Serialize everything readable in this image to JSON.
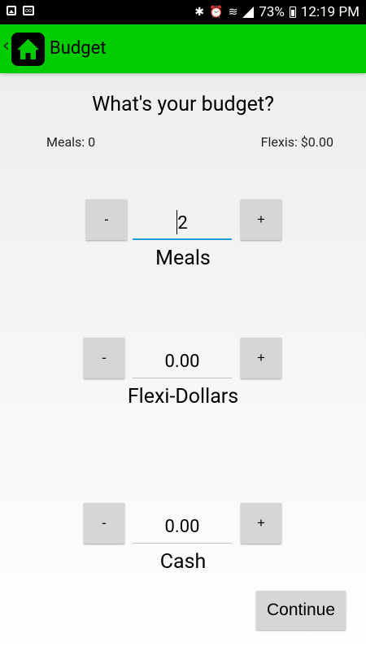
{
  "status_bar": {
    "battery": "73%",
    "time": "12:19 PM",
    "icons": [
      "image-icon",
      "voicemail-icon",
      "bluetooth-icon",
      "alarm-icon",
      "wifi-icon",
      "signal-icon",
      "battery-icon"
    ]
  },
  "app_bar": {
    "title": "Budget",
    "back_symbol": "‹",
    "accent_color": "#00cc00"
  },
  "main": {
    "heading": "What's your budget?",
    "meals_summary": "Meals: 0",
    "flexis_summary": "Flexis: $0.00",
    "sections": [
      {
        "label": "Meals",
        "value": "2",
        "minus": "-",
        "plus": "+"
      },
      {
        "label": "Flexi-Dollars",
        "value": "0.00",
        "minus": "-",
        "plus": "+"
      },
      {
        "label": "Cash",
        "value": "0.00",
        "minus": "-",
        "plus": "+"
      }
    ],
    "continue_label": "Continue"
  }
}
